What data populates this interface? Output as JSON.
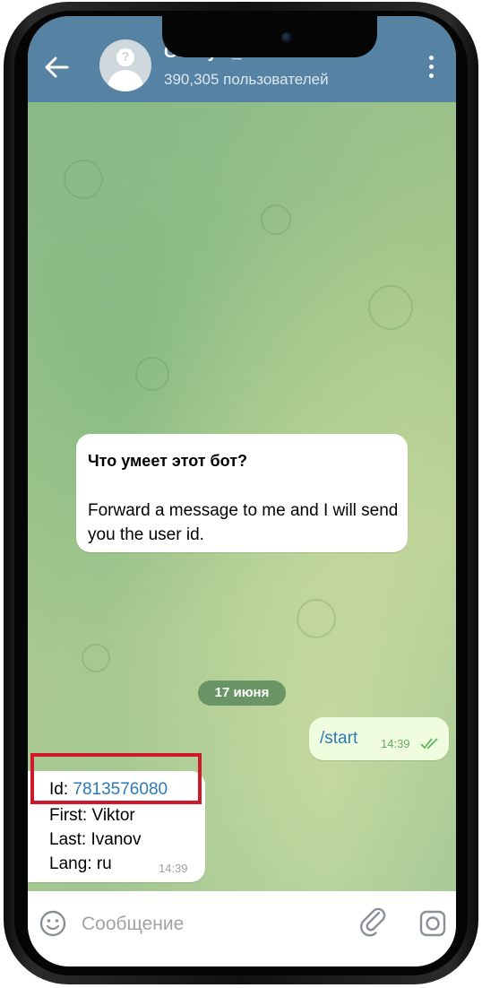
{
  "header": {
    "title": "Getmyid_bot",
    "subtitle": "390,305 пользователей"
  },
  "bot_info": {
    "title": "Что умеет этот бот?",
    "description": "Forward a message to me and I will send you the user id."
  },
  "date_separator": "17 июня",
  "outgoing_message": {
    "text": "/start",
    "time": "14:39",
    "status": "read"
  },
  "incoming_message": {
    "id_label": "Id:",
    "id_value": "7813576080",
    "first": "First: Viktor",
    "last": "Last: Ivanov",
    "lang": "Lang: ru",
    "time": "14:39"
  },
  "input": {
    "placeholder": "Сообщение"
  },
  "icons": {
    "back": "arrow-left-icon",
    "menu": "more-vertical-icon",
    "emoji": "smile-icon",
    "attach": "paperclip-icon",
    "camera": "camera-icon",
    "checks": "double-check-icon"
  },
  "colors": {
    "header": "#5682a3",
    "link": "#2d7ab7",
    "outgoing_bubble": "#effdde",
    "highlight": "#d0182c"
  }
}
